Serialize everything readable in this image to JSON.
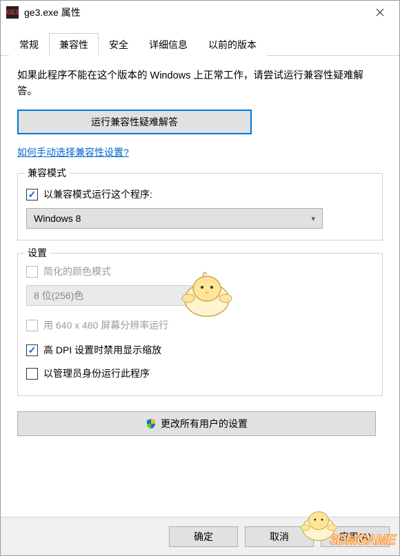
{
  "titlebar": {
    "title": "ge3.exe 属性"
  },
  "tabs": [
    {
      "label": "常规",
      "active": false
    },
    {
      "label": "兼容性",
      "active": true
    },
    {
      "label": "安全",
      "active": false
    },
    {
      "label": "详细信息",
      "active": false
    },
    {
      "label": "以前的版本",
      "active": false
    }
  ],
  "intro": "如果此程序不能在这个版本的 Windows 上正常工作，请尝试运行兼容性疑难解答。",
  "troubleshoot_button": "运行兼容性疑难解答",
  "help_link": "如何手动选择兼容性设置?",
  "compat_mode": {
    "group_label": "兼容模式",
    "checkbox_label": "以兼容模式运行这个程序:",
    "checked": true,
    "selected_os": "Windows 8"
  },
  "settings": {
    "group_label": "设置",
    "reduced_color": {
      "label": "简化的颜色模式",
      "checked": false,
      "disabled": true
    },
    "color_depth_selected": "8 位(256)色",
    "run_640x480": {
      "label": "用 640 x 480 屏幕分辨率运行",
      "checked": false,
      "disabled": true
    },
    "disable_dpi_scaling": {
      "label": "高 DPI 设置时禁用显示缩放",
      "checked": true
    },
    "run_as_admin": {
      "label": "以管理员身份运行此程序",
      "checked": false
    }
  },
  "change_all_users_button": "更改所有用户的设置",
  "footer": {
    "ok": "确定",
    "cancel": "取消",
    "apply": "应用(A)"
  },
  "watermark": "3DMGAME"
}
